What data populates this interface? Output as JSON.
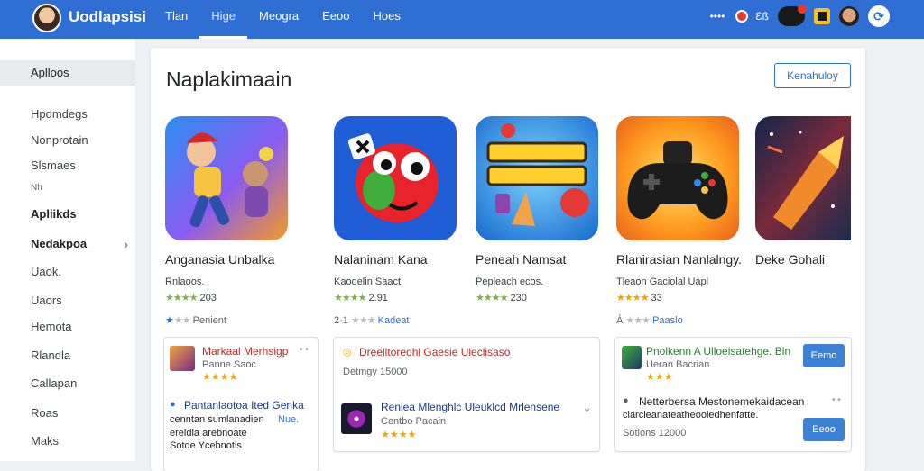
{
  "header": {
    "brand": "Uodlapsisi",
    "nav": [
      "Tlan",
      "Hige",
      "Meogra",
      "Eeoo",
      "Hoes"
    ],
    "active_nav": 1,
    "right_text": "Ɛß",
    "right_dots": "••••",
    "gear_glyph": "⟳"
  },
  "sidebar": {
    "items": [
      {
        "label": "Aplloos",
        "style": "active"
      },
      {
        "label": "Hpdmdegs",
        "style": ""
      },
      {
        "label": "Nonprotain",
        "style": ""
      },
      {
        "label": "Slsmaes",
        "style": ""
      },
      {
        "label": "Nh",
        "style": "small"
      },
      {
        "label": "Apliikds",
        "style": "bold"
      },
      {
        "label": "Nedakpoa",
        "style": "bold",
        "chevron": "›"
      },
      {
        "label": "Uaok.",
        "style": ""
      },
      {
        "label": "Uaors",
        "style": ""
      },
      {
        "label": "Hemota",
        "style": ""
      },
      {
        "label": "Rlandla",
        "style": ""
      },
      {
        "label": "Callapan",
        "style": ""
      },
      {
        "label": "Roas",
        "style": ""
      },
      {
        "label": "Maks",
        "style": ""
      }
    ]
  },
  "main": {
    "title": "Naplakimaain",
    "action_label": "Kenahuloy",
    "apps": [
      {
        "name": "Anganasia Unbalka",
        "sub": "Rnlaoos.",
        "stars": "★★★★",
        "count": "203",
        "meta_stars": "★",
        "meta_grey": "★★",
        "meta_text": "Penient",
        "meta_link": ""
      },
      {
        "name": "Nalaninam Kana",
        "sub": "Kaodelin Saact.",
        "stars": "★★★★",
        "count": "2.91",
        "meta_pre": "2·1",
        "meta_grey": "★★★",
        "meta_text": "",
        "meta_link": "Kadeat"
      },
      {
        "name": "Peneah Namsat",
        "sub": "Pepleach ecos.",
        "stars": "★★★★",
        "count": "230",
        "meta_stars": "",
        "meta_grey": "",
        "meta_text": "",
        "meta_link": ""
      },
      {
        "name": "Rlanirasian Nanlalngy.",
        "sub": "Tleaon Gaciolal Uapl",
        "stars": "★★★★",
        "count": "33",
        "meta_pre": "Á",
        "meta_grey": "★★★",
        "meta_text": "",
        "meta_link": "Paaslo"
      },
      {
        "name": "Deke Gohali",
        "sub": "",
        "stars": "",
        "count": "",
        "meta_stars": "",
        "meta_grey": "",
        "meta_text": "",
        "meta_link": ""
      }
    ],
    "cards": {
      "c1": {
        "title": "Markaal Merhsigp",
        "sub": "Panne Saoc",
        "stars": "★★★★",
        "title2": "Pantanlaotoa Ited Genka",
        "line2": "cenntan sumlanadien",
        "line2b": "Nue.",
        "line3": "ereldia arebnoate",
        "line4": "Sotde Ycebnotis"
      },
      "c2": {
        "title": "Dreelltoreohl Gaesie Uleclisaso",
        "sub": "Detmgy 15000",
        "title2": "Renlea Mlenghlc Uleuklcd Mrlensene",
        "sub2": "Centbo Pacain",
        "stars": "★★★★",
        "chev": "⌄"
      },
      "c3": {
        "title": "Pnolkenn A Ulloeisatehge. Bln",
        "sub": "Ueran Bacrian",
        "stars": "★★★",
        "btn1": "Eemo",
        "title2": "Netterbersa Mestonemekaidacean",
        "line2": "clarcleanateatheooiedhenfatte.",
        "line3": "Sotions 12000",
        "btn2": "Eeoo"
      }
    }
  },
  "colors": {
    "header_bg": "#2f6fd3",
    "accent": "#2f6fd3",
    "star": "#f2a600",
    "star_green": "#7cb342"
  }
}
